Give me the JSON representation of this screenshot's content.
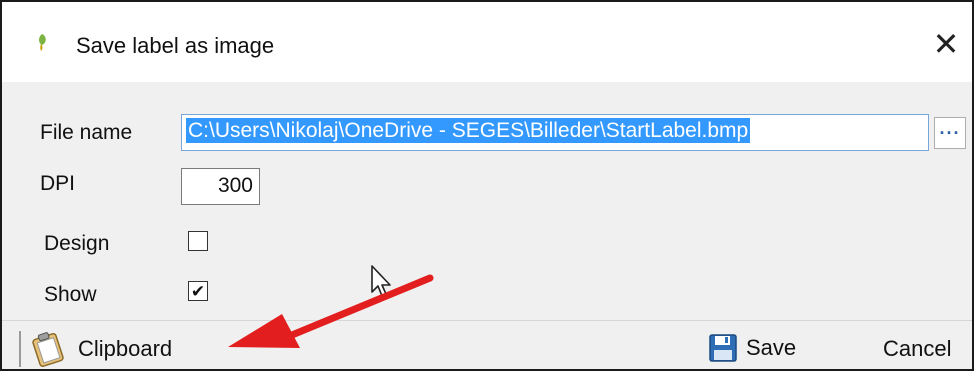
{
  "window": {
    "title": "Save label as image",
    "close_glyph": "✕"
  },
  "form": {
    "file_name_label": "File name",
    "file_name_value": "C:\\Users\\Nikolaj\\OneDrive - SEGES\\Billeder\\StartLabel.bmp",
    "browse_label": "···",
    "dpi_label": "DPI",
    "dpi_value": "300",
    "design_label": "Design",
    "design_checked": false,
    "show_label": "Show",
    "show_checked": true,
    "check_glyph": "✔"
  },
  "toolbar": {
    "clipboard_label": "Clipboard",
    "save_label": "Save",
    "cancel_label": "Cancel"
  },
  "icons": {
    "app": "app-icon",
    "clipboard": "clipboard-icon",
    "save": "save-disk-icon",
    "close": "close-icon"
  },
  "colors": {
    "selection": "#3399ff",
    "annotation_arrow": "#e31e1e",
    "window_bg": "#f0f0f0"
  }
}
